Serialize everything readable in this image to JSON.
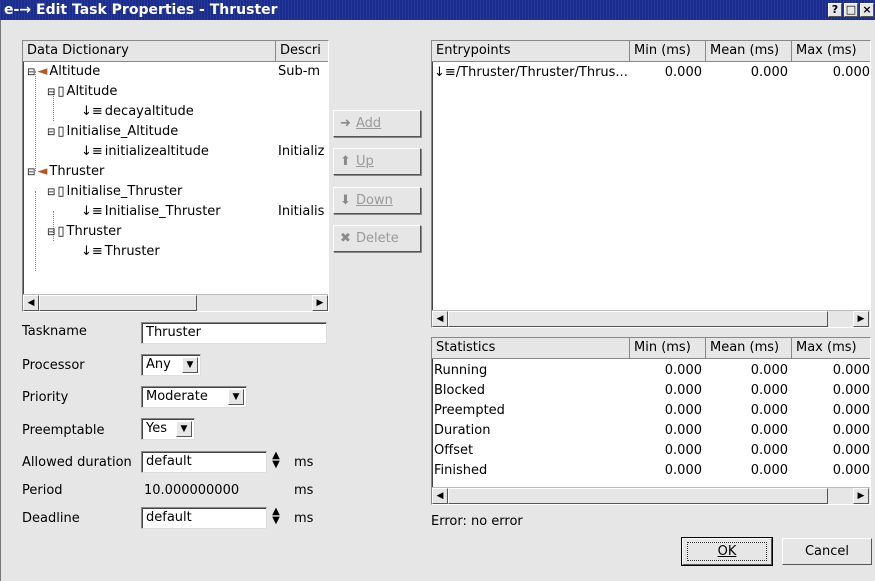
{
  "window": {
    "title": "Edit Task Properties - Thruster",
    "app_icon": "e-→ app-icon",
    "controls": [
      "?",
      "□",
      "×"
    ]
  },
  "tree": {
    "columns": [
      "Data Dictionary",
      "Descri"
    ],
    "rows": [
      {
        "label": "Altitude",
        "desc": "Sub-m",
        "icon": "folder-icon"
      },
      {
        "label": "Altitude",
        "desc": "",
        "icon": "document-icon"
      },
      {
        "label": "decayaltitude",
        "desc": "",
        "icon": "entrypoint-icon"
      },
      {
        "label": "Initialise_Altitude",
        "desc": "",
        "icon": "document-icon"
      },
      {
        "label": "initializealtitude",
        "desc": "Initializ",
        "icon": "entrypoint-icon"
      },
      {
        "label": "Thruster",
        "desc": "",
        "icon": "folder-icon"
      },
      {
        "label": "Initialise_Thruster",
        "desc": "",
        "icon": "document-icon"
      },
      {
        "label": "Initialise_Thruster",
        "desc": "Initialis",
        "icon": "entrypoint-icon"
      },
      {
        "label": "Thruster",
        "desc": "",
        "icon": "document-icon"
      },
      {
        "label": "Thruster",
        "desc": "",
        "icon": "entrypoint-icon"
      }
    ]
  },
  "form": {
    "taskname_label": "Taskname",
    "taskname_value": "Thruster",
    "processor_label": "Processor",
    "processor_value": "Any",
    "priority_label": "Priority",
    "priority_value": "Moderate",
    "preemptable_label": "Preemptable",
    "preemptable_value": "Yes",
    "allowed_duration_label": "Allowed duration",
    "allowed_duration_value": "default",
    "period_label": "Period",
    "period_value": "10.000000000",
    "deadline_label": "Deadline",
    "deadline_value": "default",
    "unit": "ms"
  },
  "buttons": {
    "add": "Add",
    "up": "Up",
    "down": "Down",
    "delete": "Delete",
    "ok": "OK",
    "cancel": "Cancel"
  },
  "entrypoints": {
    "columns": [
      "Entrypoints",
      "Min (ms)",
      "Mean (ms)",
      "Max (ms)"
    ],
    "rows": [
      {
        "name": "/Thruster/Thruster/Thrus...",
        "min": "0.000",
        "mean": "0.000",
        "max": "0.000"
      }
    ]
  },
  "statistics": {
    "columns": [
      "Statistics",
      "Min (ms)",
      "Mean (ms)",
      "Max (ms)"
    ],
    "rows": [
      {
        "name": "Running",
        "min": "0.000",
        "mean": "0.000",
        "max": "0.000"
      },
      {
        "name": "Blocked",
        "min": "0.000",
        "mean": "0.000",
        "max": "0.000"
      },
      {
        "name": "Preempted",
        "min": "0.000",
        "mean": "0.000",
        "max": "0.000"
      },
      {
        "name": "Duration",
        "min": "0.000",
        "mean": "0.000",
        "max": "0.000"
      },
      {
        "name": "Offset",
        "min": "0.000",
        "mean": "0.000",
        "max": "0.000"
      },
      {
        "name": "Finished",
        "min": "0.000",
        "mean": "0.000",
        "max": "0.000"
      }
    ]
  },
  "status": {
    "error_text": "Error:  no error"
  }
}
